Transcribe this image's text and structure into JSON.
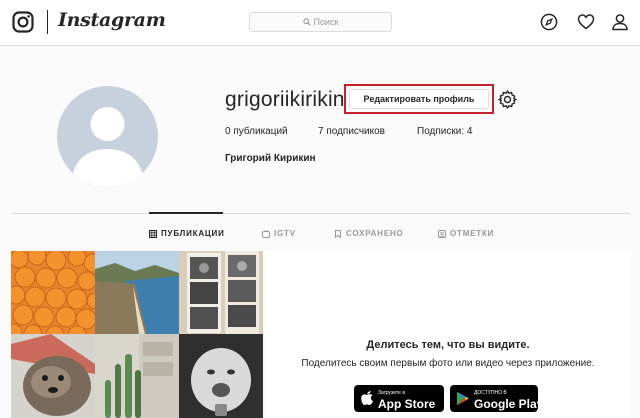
{
  "nav": {
    "app_name": "Instagram",
    "search_placeholder": "Поиск",
    "icons": [
      "instagram-glyph-icon",
      "search-icon",
      "compass-icon",
      "heart-icon",
      "person-icon"
    ]
  },
  "profile": {
    "username": "grigoriikirikin",
    "edit_button": "Редактировать профиль",
    "stats": {
      "posts": "0 публикаций",
      "followers": "7 подписчиков",
      "following": "Подписки: 4"
    },
    "full_name": "Григорий Кирикин",
    "highlight_color": "#c4232b"
  },
  "tabs": [
    {
      "label": "ПУБЛИКАЦИИ",
      "icon": "grid-icon",
      "active": true
    },
    {
      "label": "IGTV",
      "icon": "igtv-icon",
      "active": false
    },
    {
      "label": "СОХРАНЕНО",
      "icon": "bookmark-icon",
      "active": false
    },
    {
      "label": "ОТМЕТКИ",
      "icon": "tag-icon",
      "active": false
    }
  ],
  "promo": {
    "title": "Делитесь тем, что вы видите.",
    "subtitle": "Поделитесь своим первым фото или видео через приложение.",
    "app_store": {
      "small": "Загрузите в",
      "big": "App Store"
    },
    "google_play": {
      "small": "ДОСТУПНО В",
      "big": "Google Play"
    }
  }
}
